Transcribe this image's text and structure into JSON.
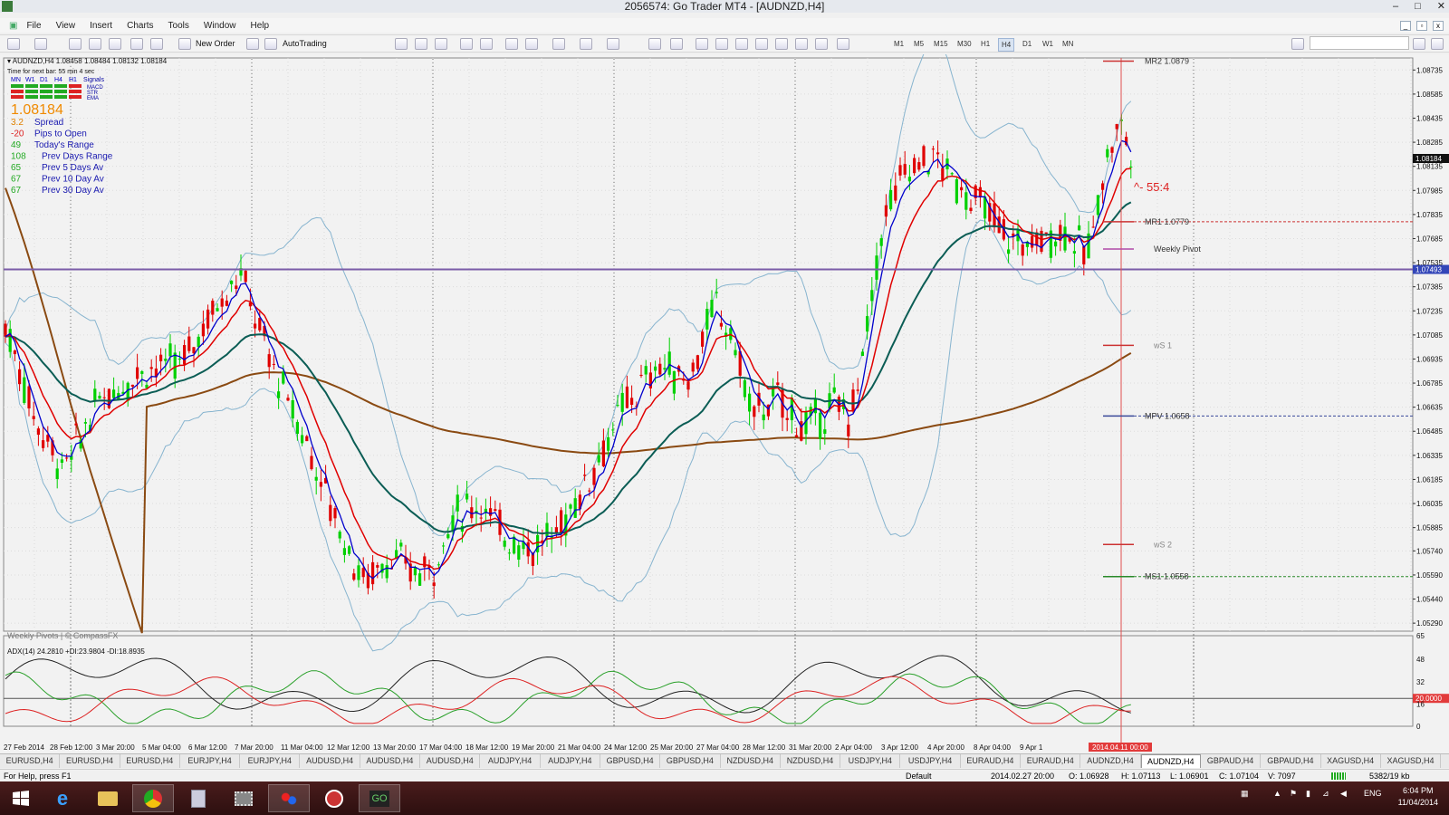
{
  "window": {
    "title": "2056574: Go Trader MT4 - [AUDNZD,H4]"
  },
  "menu": [
    "File",
    "View",
    "Insert",
    "Charts",
    "Tools",
    "Window",
    "Help"
  ],
  "toolbar": {
    "new_order": "New Order",
    "auto_trading": "AutoTrading",
    "timeframes": [
      "M1",
      "M5",
      "M15",
      "M30",
      "H1",
      "H4",
      "D1",
      "W1",
      "MN"
    ],
    "active_timeframe": "H4"
  },
  "chart": {
    "header": "AUDNZD,H4  1.08458 1.08484 1.08132 1.08184",
    "time_next_bar": "Time for next bar: 55 min 4 sec",
    "signal_cols": [
      "MN",
      "W1",
      "D1",
      "H4",
      "H1",
      "Signals"
    ],
    "signal_rows": [
      "MACD",
      "STR",
      "EMA"
    ],
    "price_big": "1.08184",
    "stats": [
      {
        "value": "3.2",
        "label": "Spread"
      },
      {
        "value": "-20",
        "label": "Pips to Open"
      },
      {
        "value": "49",
        "label": "Today's Range"
      },
      {
        "value": "108",
        "label": "Prev Days Range"
      },
      {
        "value": "65",
        "label": "Prev 5 Days Av"
      },
      {
        "value": "67",
        "label": "Prev 10 Day Av"
      },
      {
        "value": "67",
        "label": "Prev 30 Day Av"
      }
    ],
    "watermark": "Weekly Pivots | © CompassFX",
    "annotation": "^- 55:4",
    "pivots": [
      {
        "label": "MR2",
        "value": "1.0879",
        "price": 1.0879
      },
      {
        "label": "MR1",
        "value": "1.0779",
        "price": 1.0779
      },
      {
        "label": "Weekly Pivot",
        "value": "",
        "price": 1.0762
      },
      {
        "label": "wS 1",
        "value": "",
        "price": 1.0702
      },
      {
        "label": "MPV",
        "value": "1.0658",
        "price": 1.0658
      },
      {
        "label": "wS 2",
        "value": "",
        "price": 1.0578
      },
      {
        "label": "MS1",
        "value": "1.0558",
        "price": 1.0558
      }
    ],
    "horizontal_line_price": 1.07493,
    "horizontal_line_label": "1.07493",
    "current_price_label": "1.08184",
    "price_labels": [
      "1.08735",
      "1.08585",
      "1.08435",
      "1.08285",
      "1.08135",
      "1.07985",
      "1.07835",
      "1.07685",
      "1.07535",
      "1.07385",
      "1.07235",
      "1.07085",
      "1.06935",
      "1.06785",
      "1.06635",
      "1.06485",
      "1.06335",
      "1.06185",
      "1.06035",
      "1.05885",
      "1.05740",
      "1.05590",
      "1.05440",
      "1.05290"
    ],
    "adx": {
      "header": "ADX(14) 24.2810 +DI:23.9804 -DI:18.8935",
      "scale": [
        "65",
        "48",
        "32",
        "16",
        "0"
      ],
      "level_label": "20.0000"
    },
    "time_labels": [
      "27 Feb 2014",
      "28 Feb 12:00",
      "3 Mar 20:00",
      "5 Mar 04:00",
      "6 Mar 12:00",
      "7 Mar 20:00",
      "11 Mar 04:00",
      "12 Mar 12:00",
      "13 Mar 20:00",
      "17 Mar 04:00",
      "18 Mar 12:00",
      "19 Mar 20:00",
      "21 Mar 04:00",
      "24 Mar 12:00",
      "25 Mar 20:00",
      "27 Mar 04:00",
      "28 Mar 12:00",
      "31 Mar 20:00",
      "2 Apr 04:00",
      "3 Apr 12:00",
      "4 Apr 20:00",
      "8 Apr 04:00",
      "9 Apr 1"
    ],
    "time_cursor_label": "2014.04.11 00:00"
  },
  "tabs": [
    "EURUSD,H4",
    "EURUSD,H4",
    "EURUSD,H4",
    "EURJPY,H4",
    "EURJPY,H4",
    "AUDUSD,H4",
    "AUDUSD,H4",
    "AUDUSD,H4",
    "AUDJPY,H4",
    "AUDJPY,H4",
    "GBPUSD,H4",
    "GBPUSD,H4",
    "NZDUSD,H4",
    "NZDUSD,H4",
    "USDJPY,H4",
    "USDJPY,H4",
    "EURAUD,H4",
    "EURAUD,H4",
    "AUDNZD,H4",
    "AUDNZD,H4",
    "GBPAUD,H4",
    "GBPAUD,H4",
    "XAGUSD,H4",
    "XAGUSD,H4"
  ],
  "active_tab_index": 19,
  "status": {
    "help": "For Help, press F1",
    "profile": "Default",
    "datetime": "2014.02.27 20:00",
    "open": "O: 1.06928",
    "high": "H: 1.07113",
    "low": "L: 1.06901",
    "close": "C: 1.07104",
    "volume": "V: 7097",
    "traffic": "5382/19 kb"
  },
  "tray": {
    "lang": "ENG",
    "time": "6:04 PM",
    "date": "11/04/2014"
  },
  "colors": {
    "bg": "#f2f2f2",
    "bull": "#00d000",
    "bear": "#e00000",
    "ema_blue": "#0000cc",
    "ema_red": "#e00000",
    "ema_teal": "#0b5d55",
    "sma_brown": "#8a4a12",
    "bb": "#87b4cf"
  }
}
